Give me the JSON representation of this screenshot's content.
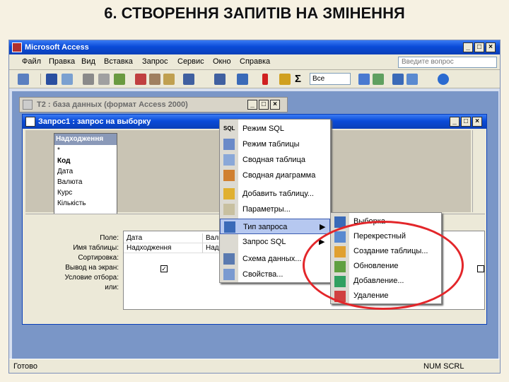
{
  "slide": {
    "title": "6. СТВОРЕННЯ ЗАПИТІВ НА ЗМІНЕННЯ"
  },
  "app": {
    "title": "Microsoft Access",
    "menu": [
      "Файл",
      "Правка",
      "Вид",
      "Вставка",
      "Запрос",
      "Сервис",
      "Окно",
      "Справка"
    ],
    "ask_placeholder": "Введите вопрос",
    "combo_value": "Все"
  },
  "db_window": {
    "title": "T2 : база данных (формат Access 2000)"
  },
  "query_window": {
    "title": "Запрос1 : запрос на выборку",
    "field_list": {
      "title": "Надходження",
      "items": [
        "*",
        "Код",
        "Дата",
        "Валюта",
        "Курс",
        "Кількість"
      ]
    },
    "grid": {
      "row_labels": [
        "Поле:",
        "Имя таблицы:",
        "Сортировка:",
        "Вывод на экран:",
        "Условие отбора:",
        "или:"
      ],
      "col1": {
        "field": "Дата",
        "table": "Надходження"
      },
      "col2": {
        "field": "Валюта",
        "table": "Надходж"
      }
    }
  },
  "context_menu": {
    "items": [
      {
        "label": "Режим SQL",
        "icon": "sql-icon"
      },
      {
        "label": "Режим таблицы",
        "icon": "datasheet-icon"
      },
      {
        "label": "Сводная таблица",
        "icon": "pivot-table-icon"
      },
      {
        "label": "Сводная диаграмма",
        "icon": "pivot-chart-icon"
      },
      {
        "label": "Добавить таблицу...",
        "icon": "add-table-icon"
      },
      {
        "label": "Параметры...",
        "icon": "parameters-icon"
      },
      {
        "label": "Тип запроса",
        "icon": "query-type-icon"
      },
      {
        "label": "Запрос SQL",
        "icon": ""
      },
      {
        "label": "Схема данных...",
        "icon": "relationships-icon"
      },
      {
        "label": "Свойства...",
        "icon": "properties-icon"
      }
    ]
  },
  "submenu": {
    "items": [
      {
        "label": "Выборка",
        "icon": "select-query-icon"
      },
      {
        "label": "Перекрестный",
        "icon": "crosstab-icon"
      },
      {
        "label": "Создание таблицы...",
        "icon": "make-table-icon"
      },
      {
        "label": "Обновление",
        "icon": "update-icon"
      },
      {
        "label": "Добавление...",
        "icon": "append-icon"
      },
      {
        "label": "Удаление",
        "icon": "delete-icon"
      }
    ]
  },
  "status": {
    "left": "Готово",
    "right": "NUM SCRL"
  },
  "colors": {
    "highlight": "#e3262a",
    "title_bar": "#0a4bd8"
  }
}
